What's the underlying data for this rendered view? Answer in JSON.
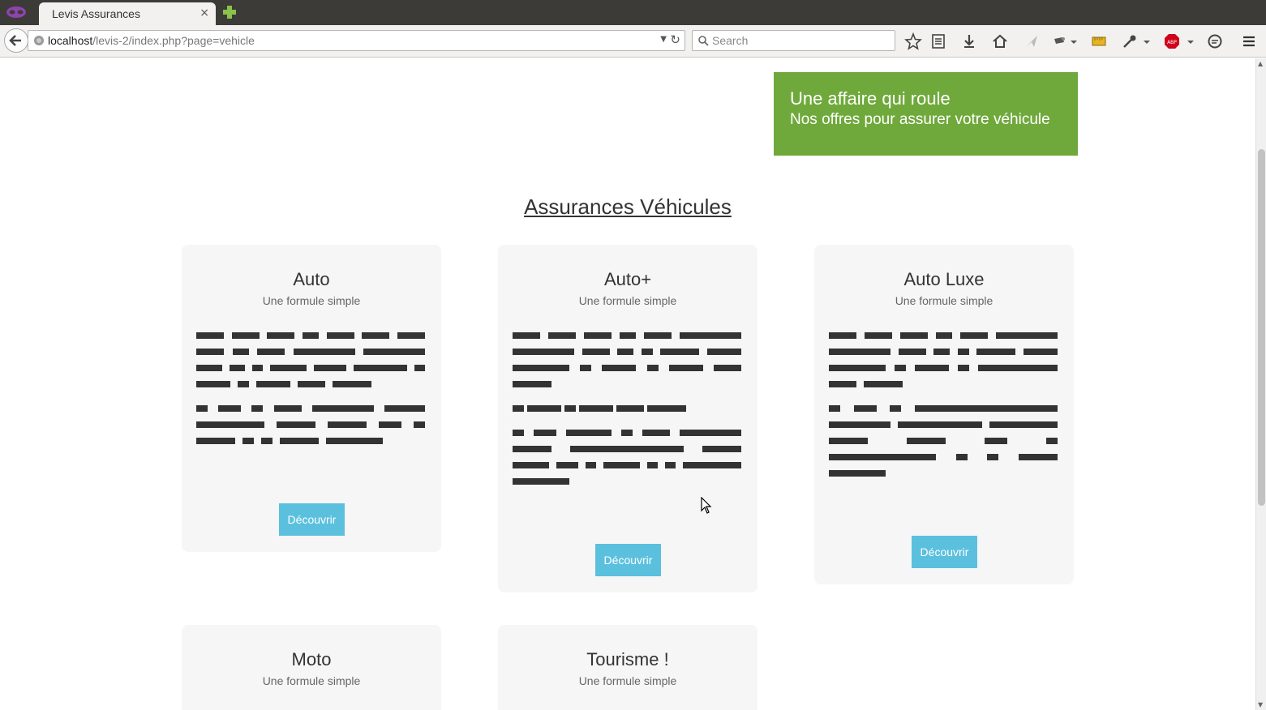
{
  "browser": {
    "tab_title": "Levis Assurances",
    "tab_close": "×",
    "url_host": "localhost",
    "url_path": "/levis-2/index.php?page=vehicle",
    "search_placeholder": "Search"
  },
  "banner": {
    "title": "Une affaire qui roule",
    "subtitle": "Nos offres pour assurer votre véhicule"
  },
  "section_title": "Assurances Véhicules",
  "cards": [
    {
      "title": "Auto",
      "subtitle": "Une formule simple",
      "button": "Découvrir"
    },
    {
      "title": "Auto+",
      "subtitle": "Une formule simple",
      "button": "Découvrir"
    },
    {
      "title": "Auto Luxe",
      "subtitle": "Une formule simple",
      "button": "Découvrir"
    },
    {
      "title": "Moto",
      "subtitle": "Une formule simple"
    },
    {
      "title": "Tourisme !",
      "subtitle": "Une formule simple"
    }
  ],
  "colors": {
    "banner_bg": "#6fa93b",
    "button_bg": "#5bc0de",
    "card_bg": "#f6f6f6"
  }
}
